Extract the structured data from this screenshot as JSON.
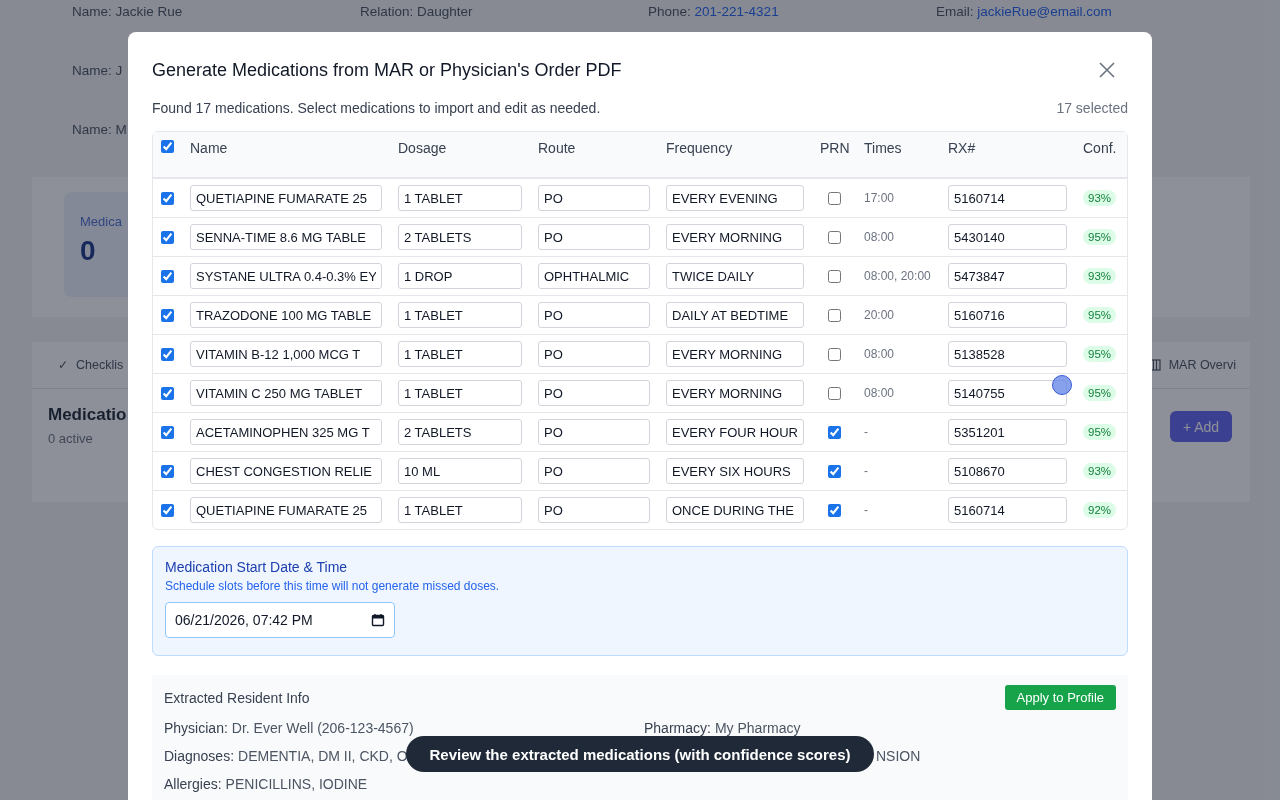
{
  "background": {
    "contact_rows": [
      [
        {
          "label": "Name:",
          "value": "Jackie Rue",
          "kind": "text"
        },
        {
          "label": "Relation:",
          "value": "Daughter",
          "kind": "text"
        },
        {
          "label": "Phone:",
          "value": "201-221-4321",
          "kind": "link"
        },
        {
          "label": "Email:",
          "value": "jackieRue@email.com",
          "kind": "link"
        }
      ],
      [
        {
          "label": "Name:",
          "value": "J",
          "kind": "text"
        }
      ],
      [
        {
          "label": "Name:",
          "value": "M",
          "kind": "text"
        }
      ]
    ],
    "stat": {
      "label": "Medica",
      "value": "0"
    },
    "tabs": [
      {
        "glyph": "✓",
        "label": "Checklis"
      },
      {
        "label": "MAR Overvi"
      }
    ],
    "section_title": "Medicatio",
    "section_count": "0 active",
    "add_button": "+ Add"
  },
  "modal": {
    "title": "Generate Medications from MAR or Physician's Order PDF",
    "summary": "Found 17 medications. Select medications to import and edit as needed.",
    "selected_count": "17 selected",
    "table": {
      "all_selected": true,
      "columns": [
        "Name",
        "Dosage",
        "Route",
        "Frequency",
        "PRN",
        "Times",
        "RX#",
        "Conf."
      ],
      "rows": [
        {
          "selected": true,
          "name": "QUETIAPINE FUMARATE 25",
          "dosage": "1 TABLET",
          "route": "PO",
          "frequency": "EVERY EVENING",
          "prn": false,
          "times": "17:00",
          "rx": "5160714",
          "confidence": "93%"
        },
        {
          "selected": true,
          "name": "SENNA-TIME 8.6 MG TABLE",
          "dosage": "2 TABLETS",
          "route": "PO",
          "frequency": "EVERY MORNING",
          "prn": false,
          "times": "08:00",
          "rx": "5430140",
          "confidence": "95%"
        },
        {
          "selected": true,
          "name": "SYSTANE ULTRA 0.4-0.3% EY",
          "dosage": "1 DROP",
          "route": "OPHTHALMIC",
          "frequency": "TWICE DAILY",
          "prn": false,
          "times": "08:00, 20:00",
          "rx": "5473847",
          "confidence": "93%"
        },
        {
          "selected": true,
          "name": "TRAZODONE 100 MG TABLE",
          "dosage": "1 TABLET",
          "route": "PO",
          "frequency": "DAILY AT BEDTIME",
          "prn": false,
          "times": "20:00",
          "rx": "5160716",
          "confidence": "95%"
        },
        {
          "selected": true,
          "name": "VITAMIN B-12 1,000 MCG T",
          "dosage": "1 TABLET",
          "route": "PO",
          "frequency": "EVERY MORNING",
          "prn": false,
          "times": "08:00",
          "rx": "5138528",
          "confidence": "95%"
        },
        {
          "selected": true,
          "name": "VITAMIN C 250 MG TABLET",
          "dosage": "1 TABLET",
          "route": "PO",
          "frequency": "EVERY MORNING",
          "prn": false,
          "times": "08:00",
          "rx": "5140755",
          "confidence": "95%"
        },
        {
          "selected": true,
          "name": "ACETAMINOPHEN 325 MG T",
          "dosage": "2 TABLETS",
          "route": "PO",
          "frequency": "EVERY FOUR HOUR",
          "prn": true,
          "times": "-",
          "rx": "5351201",
          "confidence": "95%"
        },
        {
          "selected": true,
          "name": "CHEST CONGESTION RELIE",
          "dosage": "10 ML",
          "route": "PO",
          "frequency": "EVERY SIX HOURS",
          "prn": true,
          "times": "-",
          "rx": "5108670",
          "confidence": "93%"
        },
        {
          "selected": true,
          "name": "QUETIAPINE FUMARATE 25",
          "dosage": "1 TABLET",
          "route": "PO",
          "frequency": "ONCE DURING THE",
          "prn": true,
          "times": "-",
          "rx": "5160714",
          "confidence": "92%"
        }
      ]
    },
    "start": {
      "title": "Medication Start Date & Time",
      "hint": "Schedule slots before this time will not generate missed doses.",
      "value": "06/21/2026, 07:42 PM"
    },
    "resident_info": {
      "title": "Extracted Resident Info",
      "apply_button": "Apply to Profile",
      "fields": [
        {
          "kind": "half",
          "label": "Physician:",
          "value": "Dr. Ever Well (206-123-4567)"
        },
        {
          "kind": "half",
          "label": "Pharmacy:",
          "value": "My Pharmacy"
        },
        {
          "kind": "split",
          "label": "Diagnoses:",
          "value": "DEMENTIA, DM II, CKD, O",
          "tail": "NSION"
        },
        {
          "kind": "full",
          "label": "Allergies:",
          "value": "PENICILLINS, IODINE"
        }
      ]
    }
  },
  "toast": "Review the extracted medications (with confidence scores)"
}
